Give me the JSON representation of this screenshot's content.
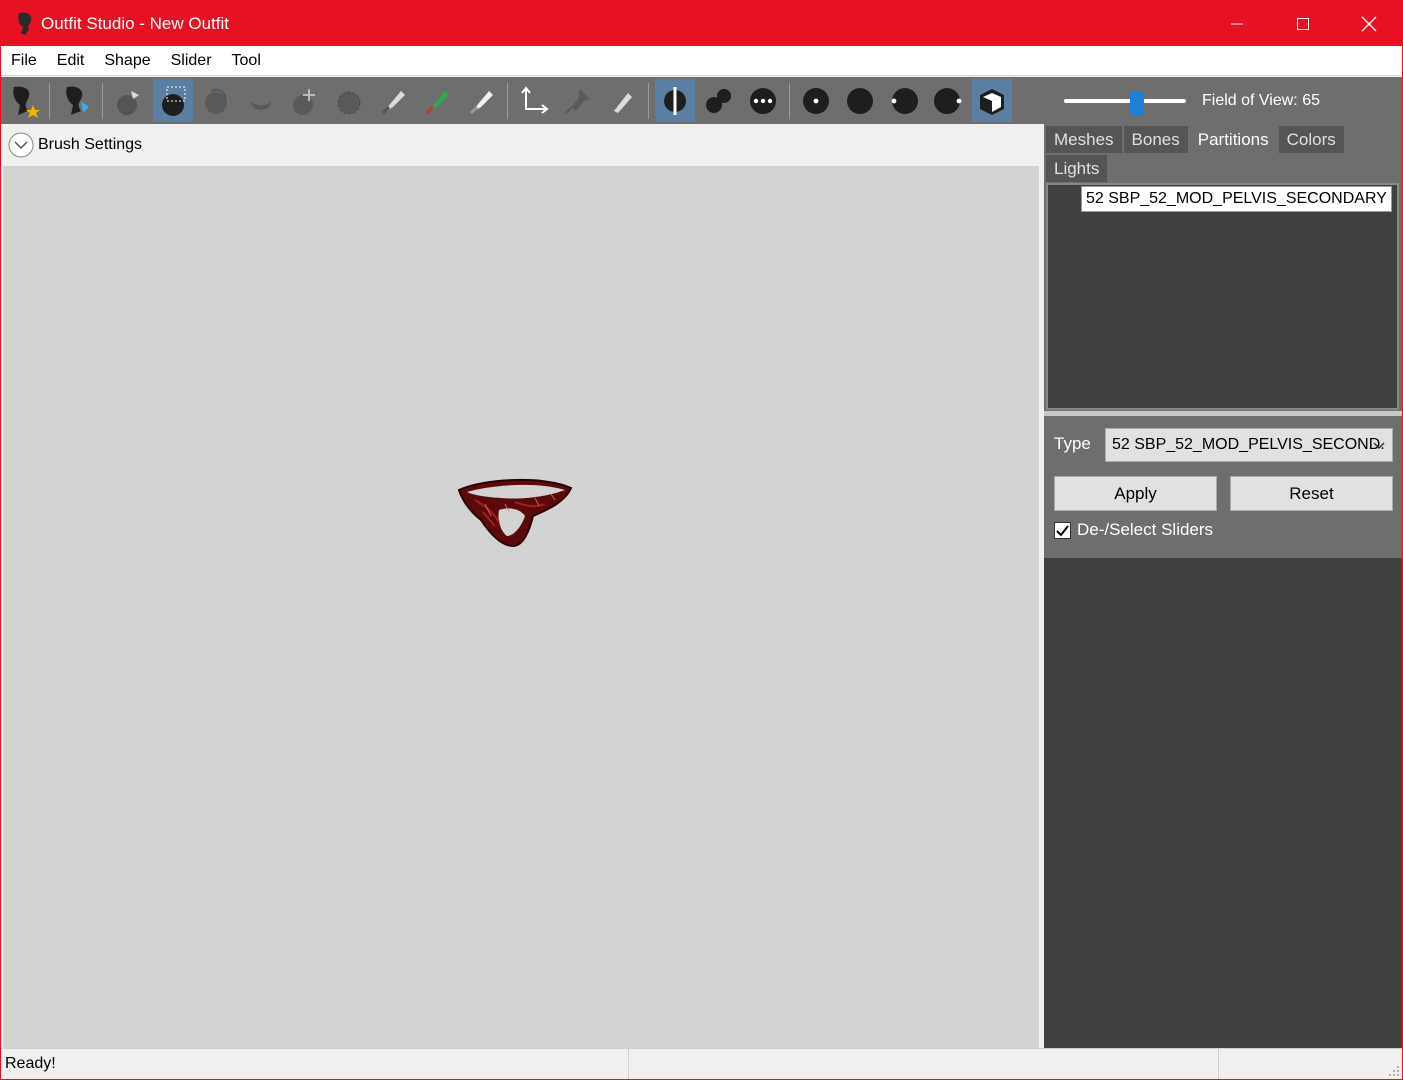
{
  "window": {
    "title": "Outfit Studio - New Outfit",
    "accent_color": "#e81123"
  },
  "menu": {
    "items": [
      "File",
      "Edit",
      "Shape",
      "Slider",
      "Tool"
    ]
  },
  "toolbar": {
    "tools": [
      {
        "icon": "new-project-icon",
        "active": false
      },
      {
        "icon": "load-reference-icon",
        "active": false
      },
      {
        "icon": "select-brush-icon",
        "active": false
      },
      {
        "icon": "mask-brush-icon",
        "active": true
      },
      {
        "icon": "inflate-brush-icon",
        "active": false
      },
      {
        "icon": "deflate-brush-icon",
        "active": false
      },
      {
        "icon": "move-brush-icon",
        "active": false
      },
      {
        "icon": "smooth-brush-icon",
        "active": false
      },
      {
        "icon": "weight-brush-icon",
        "active": false
      },
      {
        "icon": "color-brush-icon",
        "active": false
      },
      {
        "icon": "alpha-brush-icon",
        "active": false
      },
      {
        "icon": "transform-icon",
        "active": false
      },
      {
        "icon": "pivot-icon",
        "active": false
      },
      {
        "icon": "vertex-edit-icon",
        "active": false
      },
      {
        "icon": "x-mirror-icon",
        "active": true
      },
      {
        "icon": "connected-only-icon",
        "active": false
      },
      {
        "icon": "global-brush-icon",
        "active": false
      },
      {
        "icon": "show-vertices-icon",
        "active": false
      },
      {
        "icon": "wireframe-icon",
        "active": false
      },
      {
        "icon": "lighting-icon",
        "active": false
      },
      {
        "icon": "textures-icon",
        "active": false
      },
      {
        "icon": "render-mode-icon",
        "active": true
      }
    ],
    "field_of_view": {
      "label": "Field of View: 65",
      "value": 65,
      "min": 10,
      "max": 100
    }
  },
  "brush_settings": {
    "label": "Brush Settings"
  },
  "viewport": {
    "background": "#d3d3d3"
  },
  "right_panel": {
    "tabs": [
      {
        "label": "Meshes",
        "selected": false
      },
      {
        "label": "Bones",
        "selected": false
      },
      {
        "label": "Partitions",
        "selected": true
      },
      {
        "label": "Colors",
        "selected": false
      },
      {
        "label": "Lights",
        "selected": false
      }
    ],
    "partitions": [
      "52 SBP_52_MOD_PELVIS_SECONDARY"
    ],
    "type_label": "Type",
    "type_value": "52 SBP_52_MOD_PELVIS_SECOND.",
    "apply_label": "Apply",
    "reset_label": "Reset",
    "deselect_sliders": {
      "label": "De-/Select Sliders",
      "checked": true
    }
  },
  "status": {
    "text": "Ready!"
  }
}
